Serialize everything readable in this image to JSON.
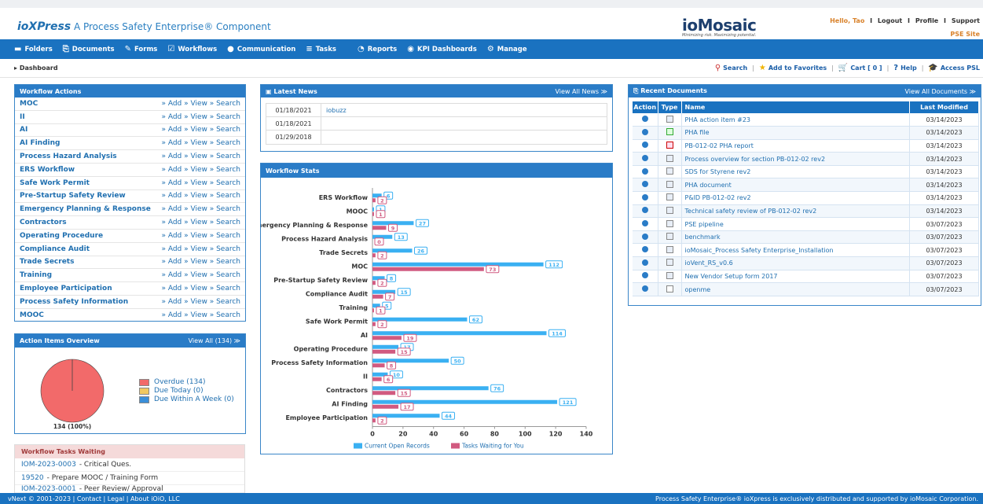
{
  "header": {
    "brand": "ioXPress",
    "tagline": "A Process Safety Enterprise® Component",
    "partner_logo": "ioMosaic",
    "partner_tagline": "Minimizing risk. Maximizing potential.",
    "user_greeting": "Hello, Tao",
    "links": [
      "Logout",
      "Profile",
      "Support"
    ],
    "site_link": "PSE Site"
  },
  "nav": [
    {
      "label": "Folders",
      "icon": "folder-icon"
    },
    {
      "label": "Documents",
      "icon": "documents-icon"
    },
    {
      "label": "Forms",
      "icon": "forms-icon"
    },
    {
      "label": "Workflows",
      "icon": "workflows-icon"
    },
    {
      "label": "Communication",
      "icon": "communication-icon"
    },
    {
      "label": "Tasks",
      "icon": "tasks-icon"
    },
    {
      "label": "Reports",
      "icon": "reports-icon"
    },
    {
      "label": "KPI Dashboards",
      "icon": "kpi-icon"
    },
    {
      "label": "Manage",
      "icon": "manage-icon"
    }
  ],
  "breadcrumb": "Dashboard",
  "toolbar": {
    "search": "Search",
    "favorites": "Add to Favorites",
    "cart": "Cart [ 0 ]",
    "help": "Help",
    "access": "Access PSL"
  },
  "workflow_actions": {
    "title": "Workflow Actions",
    "links_label": "» Add » View » Search",
    "items": [
      "MOC",
      "II",
      "AI",
      "AI Finding",
      "Process Hazard Analysis",
      "ERS Workflow",
      "Safe Work Permit",
      "Pre-Startup Safety Review",
      "Emergency Planning & Response",
      "Contractors",
      "Operating Procedure",
      "Compliance Audit",
      "Trade Secrets",
      "Training",
      "Employee Participation",
      "Process Safety Information",
      "MOOC"
    ]
  },
  "action_items": {
    "title": "Action Items Overview",
    "view_all": "View All (134) ≫",
    "pie_label": "134 (100%)",
    "legend": [
      {
        "label": "Overdue (134)",
        "color": "#f26a6a"
      },
      {
        "label": "Due Today (0)",
        "color": "#f2c860"
      },
      {
        "label": "Due Within A Week (0)",
        "color": "#3a8fd9"
      }
    ],
    "values": [
      134,
      0,
      0
    ]
  },
  "tasks_waiting": {
    "title": "Workflow Tasks Waiting",
    "items": [
      {
        "id": "IOM-2023-0003",
        "text": " - Critical Ques."
      },
      {
        "id": "19520",
        "text": " - Prepare MOOC / Training Form"
      },
      {
        "id": "IOM-2023-0001",
        "text": " - Peer Review/ Approval"
      }
    ]
  },
  "latest_news": {
    "title": "Latest News",
    "view_all": "View All News ≫",
    "rows": [
      {
        "date": "01/18/2021",
        "text": "iobuzz"
      },
      {
        "date": "01/18/2021",
        "text": ""
      },
      {
        "date": "01/29/2018",
        "text": ""
      }
    ]
  },
  "workflow_stats": {
    "title": "Workflow Stats"
  },
  "chart_data": {
    "type": "bar",
    "orientation": "horizontal",
    "categories": [
      "ERS Workflow",
      "MOOC",
      "Emergency Planning & Response",
      "Process Hazard Analysis",
      "Trade Secrets",
      "MOC",
      "Pre-Startup Safety Review",
      "Compliance Audit",
      "Training",
      "Safe Work Permit",
      "AI",
      "Operating Procedure",
      "Process Safety Information",
      "II",
      "Contractors",
      "AI Finding",
      "Employee Participation"
    ],
    "series": [
      {
        "name": "Current Open Records",
        "color": "#3ab0f2",
        "values": [
          6,
          1,
          27,
          13,
          26,
          112,
          8,
          15,
          5,
          62,
          114,
          17,
          50,
          10,
          76,
          121,
          44
        ]
      },
      {
        "name": "Tasks Waiting for You",
        "color": "#d15a80",
        "values": [
          2,
          1,
          9,
          0,
          2,
          73,
          2,
          7,
          1,
          2,
          19,
          15,
          8,
          6,
          15,
          17,
          2
        ]
      }
    ],
    "xlim": [
      0,
      140
    ],
    "xticks": [
      0,
      20,
      40,
      60,
      80,
      100,
      120,
      140
    ],
    "legend_position": "bottom",
    "grid": false
  },
  "recent_documents": {
    "title": "Recent Documents",
    "view_all": "View All Documents ≫",
    "columns": [
      "Action",
      "Type",
      "Name",
      "Last Modified"
    ],
    "rows": [
      {
        "type": "doc",
        "name": "PHA action item #23",
        "date": "03/14/2023"
      },
      {
        "type": "xls",
        "name": "PHA file",
        "date": "03/14/2023"
      },
      {
        "type": "pdf",
        "name": "PB-012-02 PHA report",
        "date": "03/14/2023"
      },
      {
        "type": "doc",
        "name": "Process overview for section PB-012-02 rev2",
        "date": "03/14/2023"
      },
      {
        "type": "doc",
        "name": "SDS for Styrene rev2",
        "date": "03/14/2023"
      },
      {
        "type": "doc",
        "name": "PHA document",
        "date": "03/14/2023"
      },
      {
        "type": "doc",
        "name": "P&ID PB-012-02 rev2",
        "date": "03/14/2023"
      },
      {
        "type": "doc",
        "name": "Technical safety review of PB-012-02 rev2",
        "date": "03/14/2023"
      },
      {
        "type": "doc",
        "name": "PSE pipeline",
        "date": "03/07/2023"
      },
      {
        "type": "doc",
        "name": "benchmark",
        "date": "03/07/2023"
      },
      {
        "type": "doc",
        "name": "ioMosaic_Process Safety Enterprise_Installation",
        "date": "03/07/2023"
      },
      {
        "type": "doc",
        "name": "ioVent_RS_v0.6",
        "date": "03/07/2023"
      },
      {
        "type": "doc",
        "name": "New Vendor Setup form 2017",
        "date": "03/07/2023"
      },
      {
        "type": "file",
        "name": "openme",
        "date": "03/07/2023"
      }
    ]
  },
  "footer": {
    "left_prefix": "vNext © 2001-2023 |",
    "links": [
      "Contact",
      "Legal",
      "About iOiO, LLC"
    ],
    "right": "Process Safety Enterprise® ioXpress is exclusively distributed and supported by ioMosaic Corporation."
  }
}
